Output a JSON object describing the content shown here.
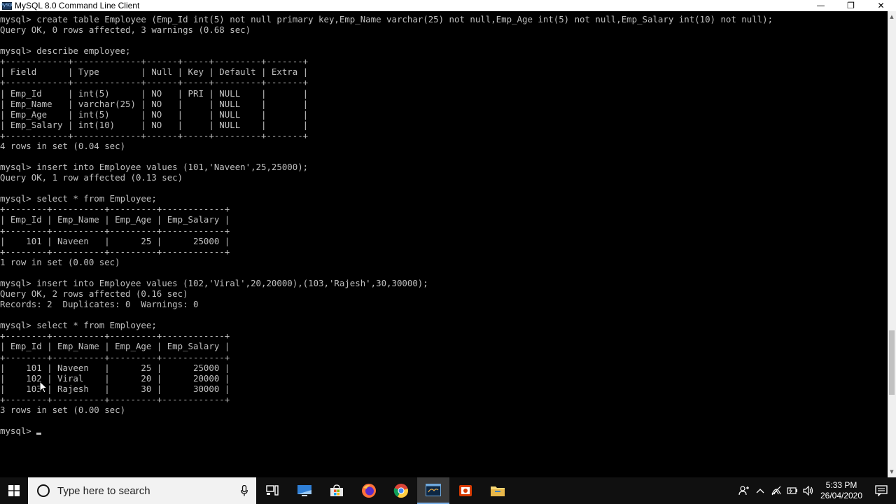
{
  "window": {
    "title": "MySQL 8.0 Command Line Client",
    "app_icon_text": "MySQL",
    "controls": {
      "minimize": "—",
      "restore": "❐",
      "close": "✕"
    }
  },
  "console": {
    "text": "mysql> create table Employee (Emp_Id int(5) not null primary key,Emp_Name varchar(25) not null,Emp_Age int(5) not null,Emp_Salary int(10) not null);\nQuery OK, 0 rows affected, 3 warnings (0.68 sec)\n\nmysql> describe employee;\n+------------+-------------+------+-----+---------+-------+\n| Field      | Type        | Null | Key | Default | Extra |\n+------------+-------------+------+-----+---------+-------+\n| Emp_Id     | int(5)      | NO   | PRI | NULL    |       |\n| Emp_Name   | varchar(25) | NO   |     | NULL    |       |\n| Emp_Age    | int(5)      | NO   |     | NULL    |       |\n| Emp_Salary | int(10)     | NO   |     | NULL    |       |\n+------------+-------------+------+-----+---------+-------+\n4 rows in set (0.04 sec)\n\nmysql> insert into Employee values (101,'Naveen',25,25000);\nQuery OK, 1 row affected (0.13 sec)\n\nmysql> select * from Employee;\n+--------+----------+---------+------------+\n| Emp_Id | Emp_Name | Emp_Age | Emp_Salary |\n+--------+----------+---------+------------+\n|    101 | Naveen   |      25 |      25000 |\n+--------+----------+---------+------------+\n1 row in set (0.00 sec)\n\nmysql> insert into Employee values (102,'Viral',20,20000),(103,'Rajesh',30,30000);\nQuery OK, 2 rows affected (0.16 sec)\nRecords: 2  Duplicates: 0  Warnings: 0\n\nmysql> select * from Employee;\n+--------+----------+---------+------------+\n| Emp_Id | Emp_Name | Emp_Age | Emp_Salary |\n+--------+----------+---------+------------+\n|    101 | Naveen   |      25 |      25000 |\n|    102 | Viral    |      20 |      20000 |\n|    103 | Rajesh   |      30 |      30000 |\n+--------+----------+---------+------------+\n3 rows in set (0.00 sec)\n\nmysql> "
  },
  "taskbar": {
    "search_placeholder": "Type here to search",
    "icons": [
      "windows-start-icon",
      "task-view-icon",
      "app-icon",
      "store-icon",
      "firefox-icon",
      "chrome-icon",
      "mysql-icon",
      "office-icon",
      "file-explorer-icon"
    ],
    "tray": {
      "time": "5:33 PM",
      "date": "26/04/2020"
    }
  }
}
